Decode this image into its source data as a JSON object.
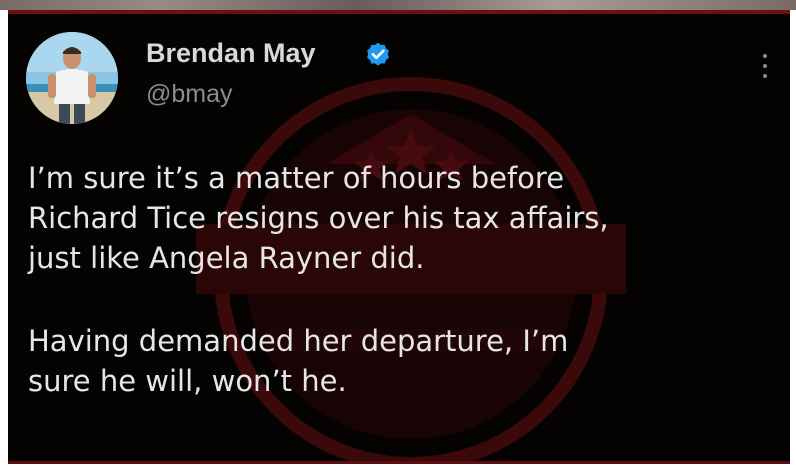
{
  "tweet": {
    "author_name": "Brendan May",
    "author_handle": "@bmay",
    "verified": true,
    "paragraphs": [
      {
        "lines": [
          "I’m sure it’s a matter of hours before",
          "Richard Tice resigns over his tax affairs,",
          "just like Angela Rayner did."
        ]
      },
      {
        "lines": [
          "Having demanded her departure, I’m",
          "sure he will, won’t he."
        ]
      }
    ]
  },
  "icons": {
    "verified": "verified-badge-icon",
    "more": "more-options-icon"
  },
  "colors": {
    "background": "#050202",
    "text": "#e6e6e6",
    "handle": "#8c8c8c",
    "verified_blue": "#1d9bf0",
    "watermark_red": "#6a0f12"
  }
}
